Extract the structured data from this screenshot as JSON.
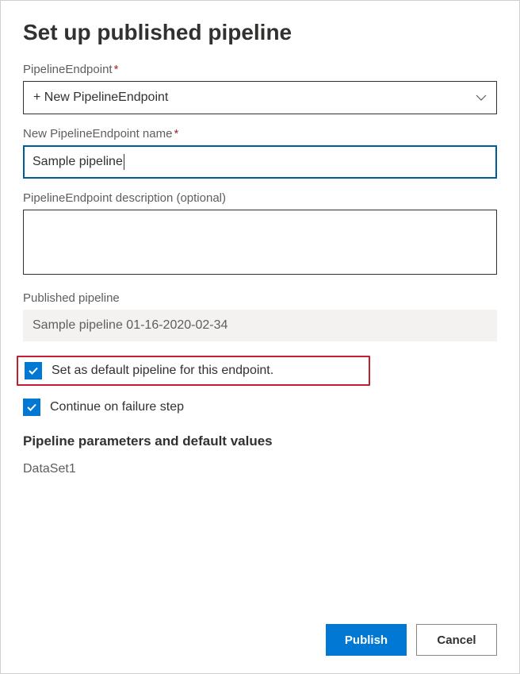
{
  "dialog": {
    "title": "Set up published pipeline"
  },
  "fields": {
    "endpoint": {
      "label": "PipelineEndpoint",
      "value": "+ New PipelineEndpoint"
    },
    "endpoint_name": {
      "label": "New PipelineEndpoint name",
      "value": "Sample pipeline"
    },
    "endpoint_description": {
      "label": "PipelineEndpoint description (optional)",
      "value": ""
    },
    "published_pipeline": {
      "label": "Published pipeline",
      "value": "Sample pipeline 01-16-2020-02-34"
    }
  },
  "checkboxes": {
    "set_default": {
      "label": "Set as default pipeline for this endpoint.",
      "checked": true
    },
    "continue_on_failure": {
      "label": "Continue on failure step",
      "checked": true
    }
  },
  "parameters": {
    "heading": "Pipeline parameters and default values",
    "items": [
      "DataSet1"
    ]
  },
  "buttons": {
    "publish": "Publish",
    "cancel": "Cancel"
  },
  "icons": {
    "chevron_down": "chevron-down-icon",
    "check": "check-icon"
  }
}
